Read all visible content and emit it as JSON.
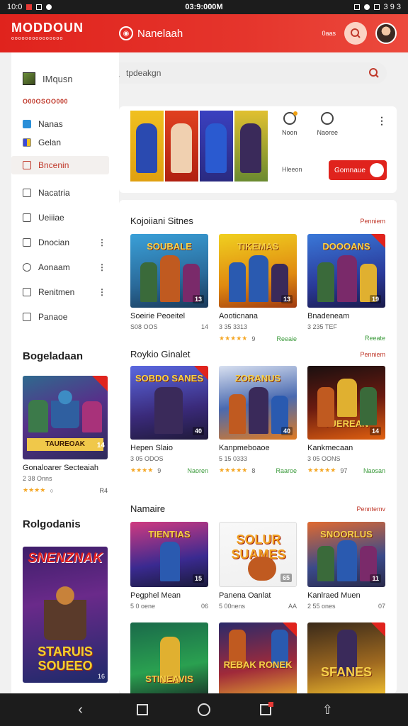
{
  "status_bar": {
    "left": "10:0",
    "time": "03:9:000M",
    "right": "3 9 3"
  },
  "header": {
    "logo": "MODDOUN",
    "logo_sub": "OOOOOOOOOOOOOOO",
    "brand": "Nanelaah",
    "mini_text": "0aas"
  },
  "search": {
    "placeholder": "tpdeakgn"
  },
  "sidebar": {
    "app_title": "IMqusn",
    "section": "O00OSOO000",
    "items": [
      {
        "label": "Nanas",
        "icon": "blue-square-icon"
      },
      {
        "label": "Gelan",
        "icon": "multicolor-square-icon"
      },
      {
        "label": "Bncenin",
        "icon": "home-icon",
        "active": true
      },
      {
        "label": "Nacatria",
        "icon": "image-icon"
      },
      {
        "label": "Ueiiiae",
        "icon": "document-icon"
      },
      {
        "label": "Dnocian",
        "icon": "card-icon"
      },
      {
        "label": "Aonaam",
        "icon": "clock-icon"
      },
      {
        "label": "Renitmen",
        "icon": "grid-icon"
      },
      {
        "label": "Panaoe",
        "icon": "file-icon"
      }
    ],
    "heading_1": "Bogeladaan",
    "card": {
      "banner": "TAUREOAK",
      "badge": "14",
      "title": "Gonaloarer Secteaiah",
      "sub": "2 38 Onns",
      "sub_right": "",
      "meta_right": "R4"
    },
    "heading_2": "Rolgodanis",
    "poster": {
      "title_top": "SNENZNAK",
      "title_bottom": "STARUIS SOUEEO",
      "badge": "16"
    }
  },
  "featured": {
    "icons": [
      {
        "label": "Noon"
      },
      {
        "label": "Naoree"
      }
    ],
    "note": "Hleeon",
    "button": "Gomnaue"
  },
  "sections": [
    {
      "title": "Kojoiiani Sitnes",
      "link": "Penniem",
      "cards": [
        {
          "tile_text": "SOUBALE",
          "badge": "13",
          "title": "Soeirie Peoeitel",
          "sub": "S08 OOS",
          "sub_right": "14",
          "stars": "",
          "num": "",
          "status": ""
        },
        {
          "tile_text": "TIKEMAS",
          "badge": "13",
          "title": "Aooticnana",
          "sub": "3 35 3313",
          "sub_right": "",
          "stars": "★★★★★",
          "num": "9",
          "status": "Reeaie"
        },
        {
          "tile_text": "DOOOANS",
          "badge": "19",
          "title": "Bnadeneam",
          "sub": "3 235 TEF",
          "sub_right": "",
          "stars": "",
          "num": "",
          "status": "Reeate"
        }
      ]
    },
    {
      "title": "Roykio Ginalet",
      "link": "Penniem",
      "cards": [
        {
          "tile_text": "SOBDO SANES",
          "badge": "40",
          "title": "Hepen Slaio",
          "sub": "3 05 ODOS",
          "sub_right": "",
          "stars": "★★★★",
          "num": "9",
          "status": "Naoren"
        },
        {
          "tile_text": "ZORANUS",
          "badge": "40",
          "title": "Kanpmeboaoe",
          "sub": "5 15 0333",
          "sub_right": "",
          "stars": "★★★★★",
          "num": "8",
          "status": "Raaroe"
        },
        {
          "tile_text": "TUEREAN",
          "badge": "14",
          "title": "Kankmecaan",
          "sub": "3 05 OONS",
          "sub_right": "",
          "stars": "★★★★★",
          "num": "97",
          "status": "Naosan"
        }
      ]
    },
    {
      "title": "Namaire",
      "link": "Penntemv",
      "cards": [
        {
          "tile_text": "TIENTIAS",
          "badge": "15",
          "title": "Pegphel Mean",
          "sub": "5 0 oene",
          "sub_right": "06",
          "stars": "",
          "num": "",
          "status": ""
        },
        {
          "tile_text": "SOLUR SUAMES",
          "badge": "65",
          "title": "Panena Oanlat",
          "sub": "5 00nens",
          "sub_right": "AA",
          "stars": "",
          "num": "",
          "status": ""
        },
        {
          "tile_text": "SNOORLUS",
          "badge": "11",
          "title": "Kanlraed Muen",
          "sub": "2 55 ones",
          "sub_right": "07",
          "stars": "",
          "num": "",
          "status": ""
        }
      ]
    },
    {
      "title": "",
      "link": "",
      "cards": [
        {
          "tile_text": "STINEAVIS",
          "badge": "",
          "title": "",
          "sub": "",
          "sub_right": "",
          "stars": "",
          "num": "",
          "status": ""
        },
        {
          "tile_text": "REBAK RONEK",
          "badge": "",
          "title": "",
          "sub": "",
          "sub_right": "",
          "stars": "",
          "num": "",
          "status": ""
        },
        {
          "tile_text": "SFANES",
          "badge": "",
          "title": "",
          "sub": "",
          "sub_right": "",
          "stars": "",
          "num": "",
          "status": ""
        }
      ]
    }
  ],
  "colors": {
    "accent": "#e0231d",
    "link": "#c0392b",
    "rating": "#f5a623",
    "status_green": "#3a9a3a"
  }
}
